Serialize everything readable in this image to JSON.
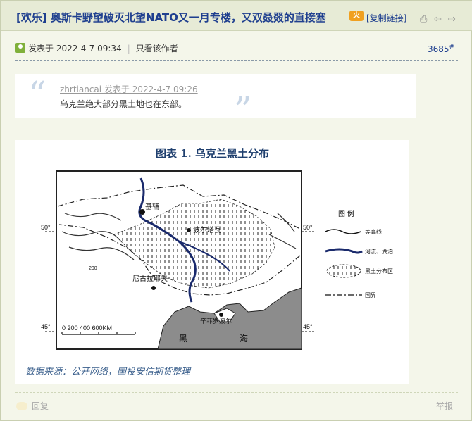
{
  "post": {
    "title": "[欢乐] 奥斯卡野望破灭北望NATO又一月专楼，又双叒叕的直接塞",
    "badge": "火",
    "copy_link": "[复制链接]",
    "tool_icons": [
      "print-icon",
      "prev-icon",
      "next-icon"
    ]
  },
  "meta": {
    "posted": "发表于 2022-4-7 09:34",
    "only_author": "只看该作者",
    "floor": "3685",
    "floor_mark": "#"
  },
  "quote": {
    "author": "zhrtiancai 发表于 2022-4-7 09:26",
    "text": "乌克兰绝大部分黑土地也在东部。"
  },
  "figure": {
    "title": "图表 1.  乌克兰黑土分布",
    "source": "数据来源：公开网络，国投安信期货整理",
    "map_labels": {
      "kyiv": "基辅",
      "poltava": "波尔塔瓦",
      "mykolaiv": "尼古拉耶夫",
      "simferopol": "辛菲罗波尔",
      "black_sea_left": "黑",
      "black_sea_right": "海",
      "lat50_left": "50°",
      "lat50_right": "50°",
      "lat45_left": "45°",
      "lat45_right": "45°",
      "scale": "0  200  400  600KM",
      "contour_200": "200"
    },
    "legend": {
      "title": "图 例",
      "items": [
        "等高线",
        "河流、湖泊",
        "黑土分布区",
        "国界"
      ]
    }
  },
  "actions": {
    "reply": "回复",
    "report": "举报"
  }
}
